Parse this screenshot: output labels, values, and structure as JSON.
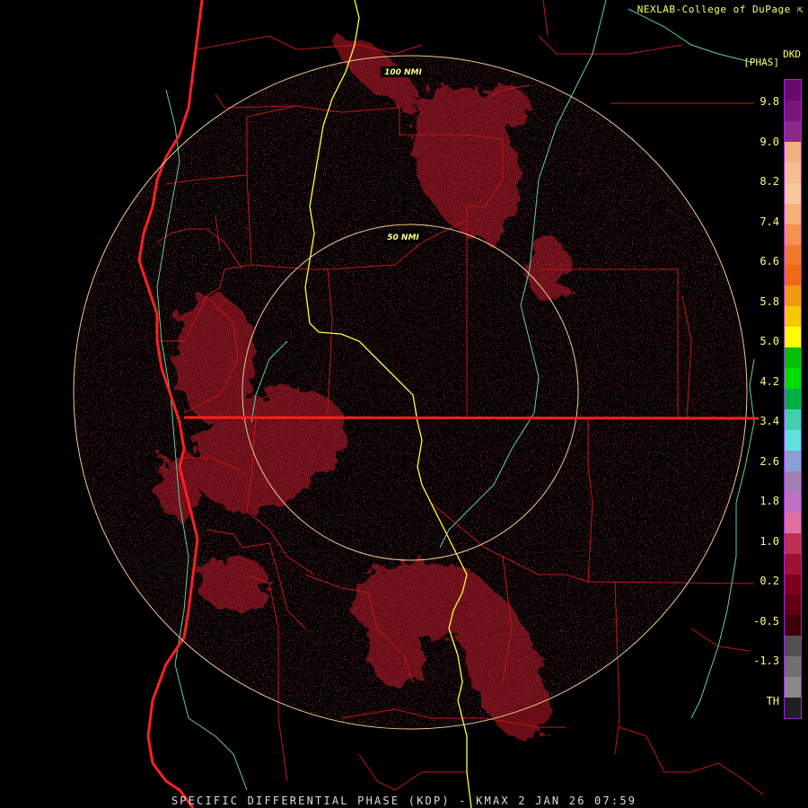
{
  "credit": "NEXLAB-College of DuPage",
  "credit_icon": "corner-arrow-icon",
  "product_code": "DKD",
  "units": "[PHAS]",
  "footer": "SPECIFIC DIFFERENTIAL PHASE (KDP) - KMAX 2 JAN 26 07:59",
  "range_rings": [
    "50 NMI",
    "100 NMI"
  ],
  "legend": {
    "ticks": [
      "9.8",
      "9.0",
      "8.2",
      "7.4",
      "6.6",
      "5.8",
      "5.0",
      "4.2",
      "3.4",
      "2.6",
      "1.8",
      "1.0",
      "0.2",
      "-0.5",
      "-1.3",
      "TH"
    ],
    "colors": [
      "#6a0a6a",
      "#7a1478",
      "#8a2a86",
      "#f2b080",
      "#f6be8e",
      "#f7c89a",
      "#f7b077",
      "#f5914f",
      "#f07a2b",
      "#ee6a1a",
      "#f19a10",
      "#f5c800",
      "#ffff00",
      "#00c000",
      "#00dd00",
      "#00b040",
      "#40d0b0",
      "#60e0e0",
      "#8aa0d0",
      "#a080b0",
      "#c070c0",
      "#e070a0",
      "#c03050",
      "#a01030",
      "#800020",
      "#600010",
      "#400008",
      "#505050",
      "#707070",
      "#8a8a8a",
      "#202020"
    ]
  },
  "colors": {
    "state_border": "#e02020",
    "county_border": "#c01818",
    "coastline": "#ff2020",
    "river": "#ffff40",
    "lake_border": "#60d0a0",
    "range_ring": "#f0c890",
    "echo": "#6a0d14",
    "artifact_line": "#ff2020"
  }
}
